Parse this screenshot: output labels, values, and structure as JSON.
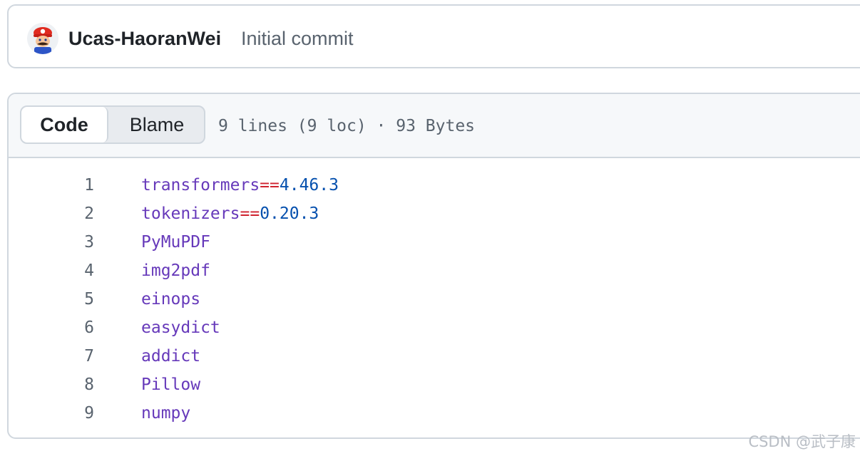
{
  "commit": {
    "author": "Ucas-HaoranWei",
    "message": "Initial commit",
    "avatar_icon": "mario-avatar-icon"
  },
  "file_header": {
    "tabs": [
      {
        "label": "Code",
        "active": true
      },
      {
        "label": "Blame",
        "active": false
      }
    ],
    "info": "9 lines (9 loc) · 93 Bytes"
  },
  "code_lines": [
    {
      "number": "1",
      "name": "transformers",
      "op": "==",
      "version": "4.46.3"
    },
    {
      "number": "2",
      "name": "tokenizers",
      "op": "==",
      "version": "0.20.3"
    },
    {
      "number": "3",
      "name": "PyMuPDF",
      "op": "",
      "version": ""
    },
    {
      "number": "4",
      "name": "img2pdf",
      "op": "",
      "version": ""
    },
    {
      "number": "5",
      "name": "einops",
      "op": "",
      "version": ""
    },
    {
      "number": "6",
      "name": "easydict",
      "op": "",
      "version": ""
    },
    {
      "number": "7",
      "name": "addict",
      "op": "",
      "version": ""
    },
    {
      "number": "8",
      "name": "Pillow",
      "op": "",
      "version": ""
    },
    {
      "number": "9",
      "name": "numpy",
      "op": "",
      "version": ""
    }
  ],
  "colors": {
    "package_name": "#6639ba",
    "operator": "#cf222e",
    "version": "#0550ae",
    "line_number": "#59636e",
    "border": "#d0d7de"
  },
  "watermark": "CSDN @武子康"
}
